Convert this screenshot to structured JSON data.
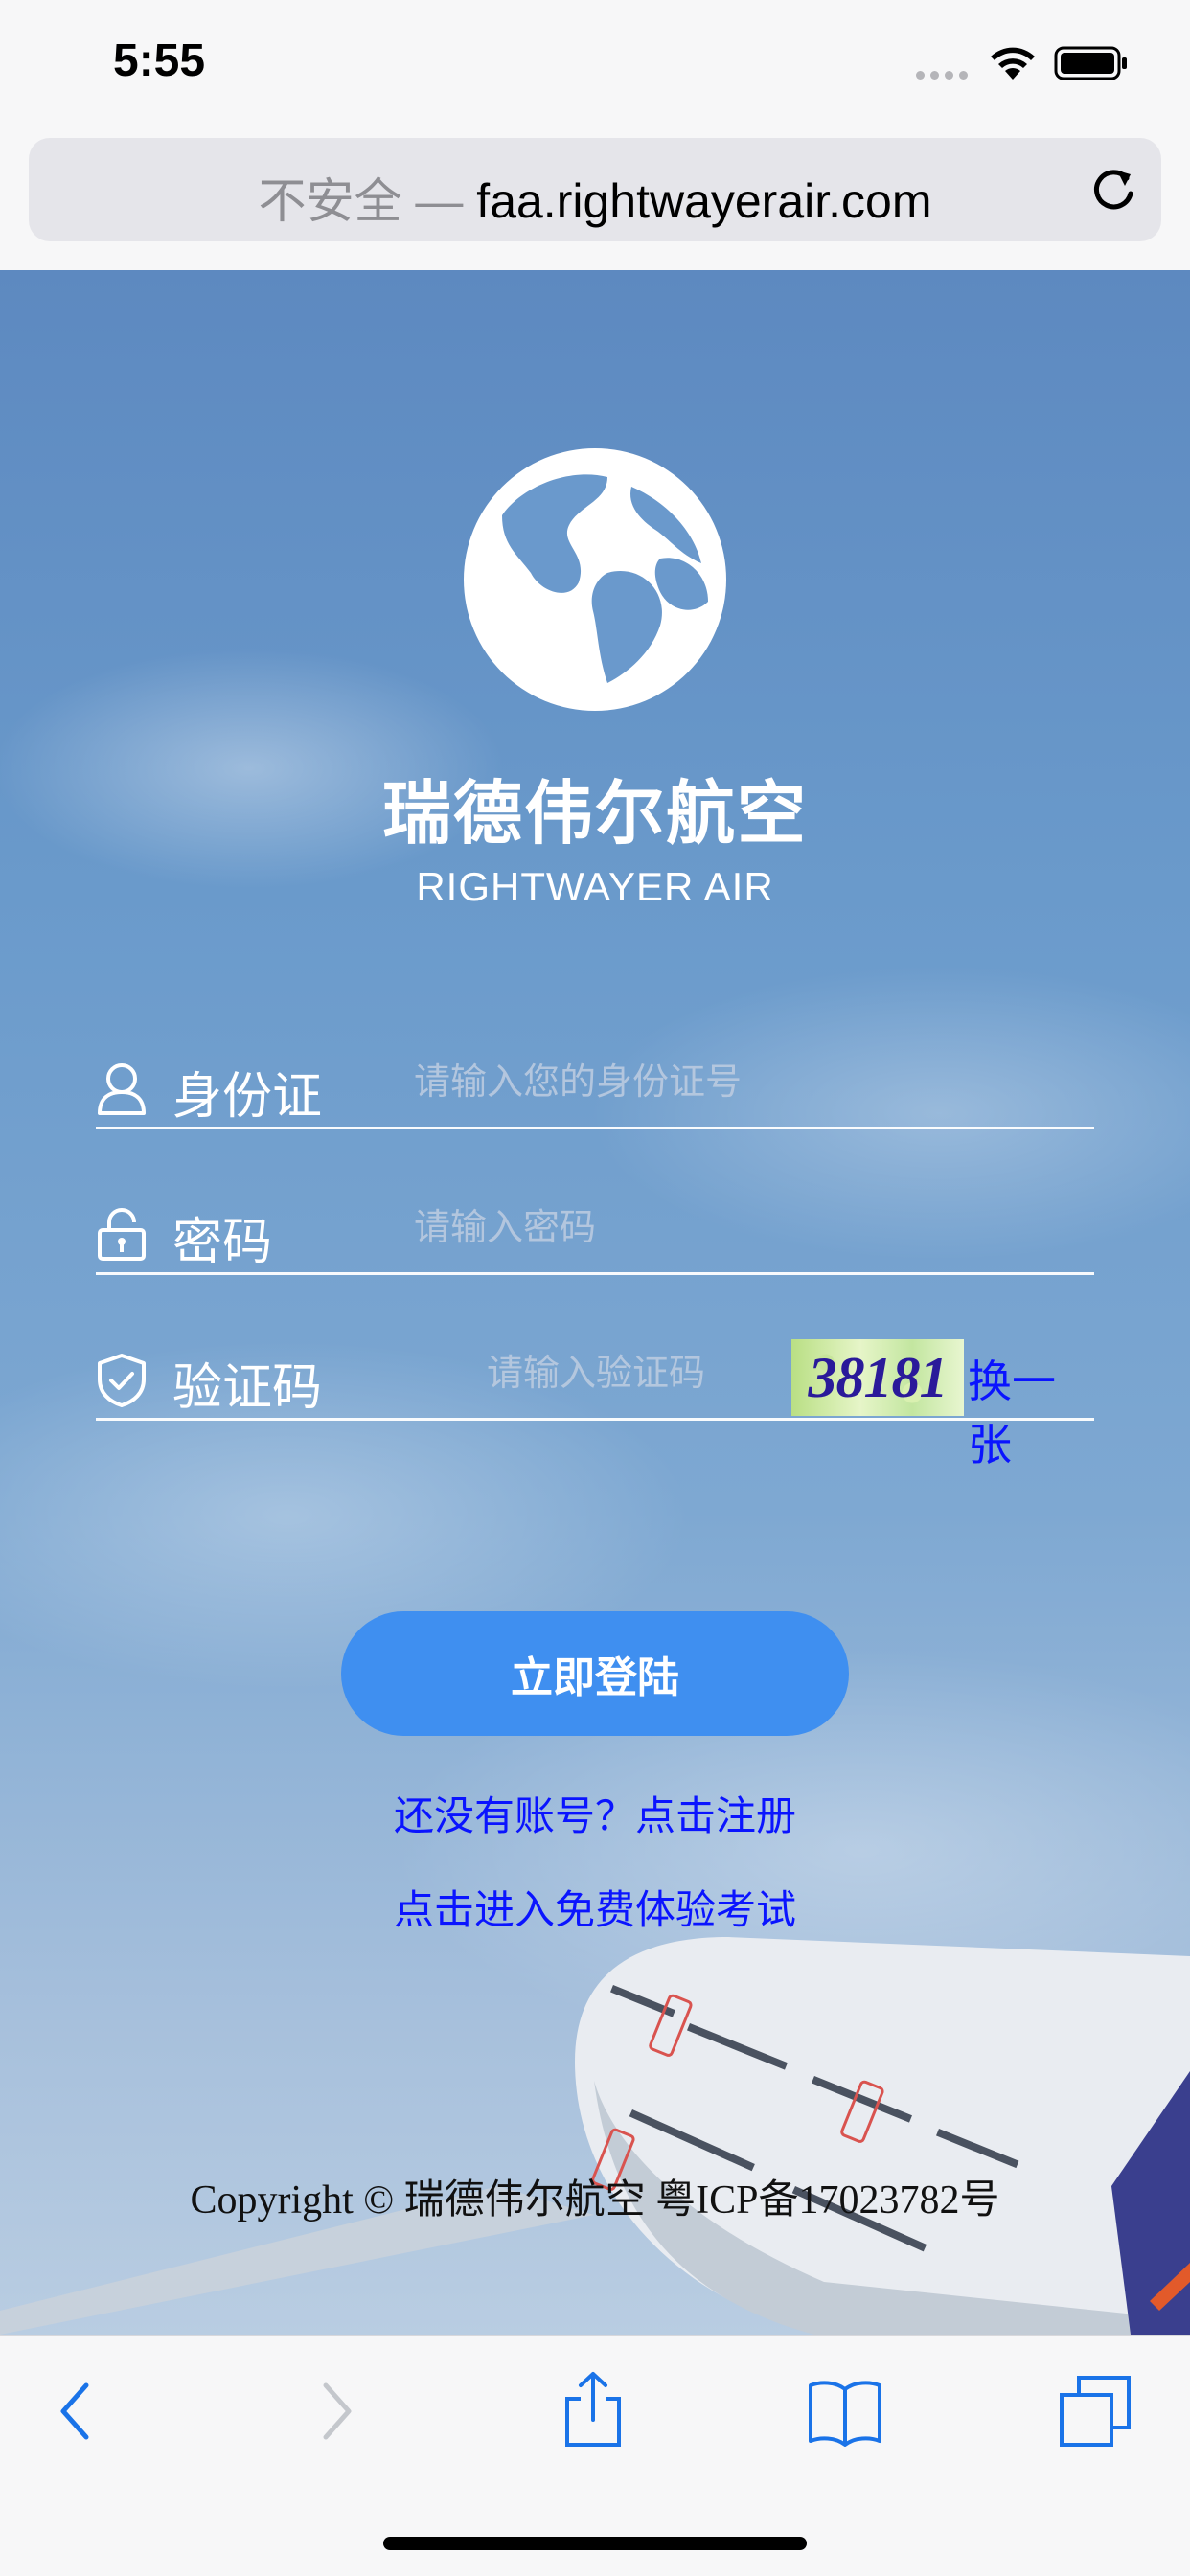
{
  "status_bar": {
    "time": "5:55"
  },
  "browser": {
    "url_insecure": "不安全 —",
    "url_domain": "faa.rightwayerair.com"
  },
  "brand": {
    "cn": "瑞德伟尔航空",
    "en": "RIGHTWAYER AIR"
  },
  "form": {
    "id_label": "身份证",
    "id_placeholder": "请输入您的身份证号",
    "password_label": "密码",
    "password_placeholder": "请输入密码",
    "captcha_label": "验证码",
    "captcha_placeholder": "请输入验证码",
    "captcha_code": "38181",
    "captcha_refresh": "换一张",
    "login_button": "立即登陆",
    "register_link": "还没有账号？点击注册",
    "trial_link": "点击进入免费体验考试"
  },
  "footer": {
    "copyright": "Copyright © 瑞德伟尔航空 粤ICP备17023782号"
  },
  "icons": {
    "back": "chevron-left-icon",
    "forward": "chevron-right-icon",
    "share": "share-icon",
    "bookmarks": "book-icon",
    "tabs": "tabs-icon",
    "reload": "reload-icon",
    "logo": "globe-icon",
    "user": "user-icon",
    "lock": "lock-icon",
    "shield": "shield-check-icon"
  },
  "colors": {
    "link": "#0a14ff",
    "button": "#3f8ff0",
    "toolbar_icon": "#1a73e8"
  }
}
